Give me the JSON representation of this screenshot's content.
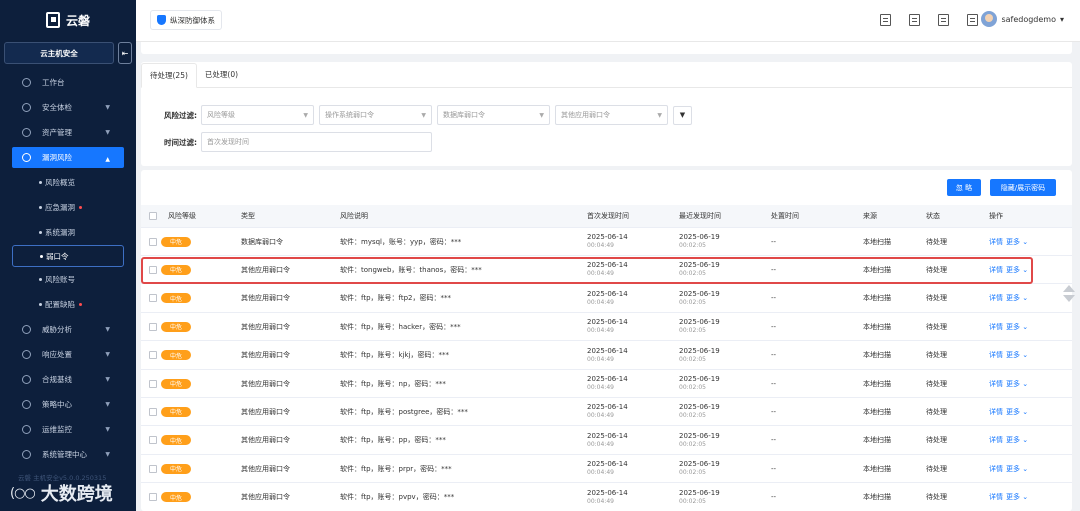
{
  "sidebar": {
    "brand": "云磐",
    "product": "云主机安全",
    "collapse_icon": "collapse-icon",
    "nav": [
      {
        "label": "工作台",
        "expandable": false
      },
      {
        "label": "安全体检",
        "expandable": true
      },
      {
        "label": "资产管理",
        "expandable": true
      }
    ],
    "active_group": "漏洞风险",
    "sub_items": [
      {
        "label": "风险概览",
        "dot": false
      },
      {
        "label": "应急漏洞",
        "dot": true
      },
      {
        "label": "系统漏洞",
        "dot": false
      },
      {
        "label": "弱口令",
        "dot": false,
        "selected": true
      },
      {
        "label": "风险账号",
        "dot": false
      },
      {
        "label": "配置缺陷",
        "dot": true
      }
    ],
    "nav_after": [
      {
        "label": "威胁分析"
      },
      {
        "label": "响应处置"
      },
      {
        "label": "合规基线"
      },
      {
        "label": "策略中心"
      },
      {
        "label": "运维监控"
      },
      {
        "label": "系统管理中心"
      }
    ],
    "version": "云磐 主机安全v5.0.0.250315",
    "watermark": "大数跨境"
  },
  "topbar": {
    "badge": "纵深防御体系",
    "username": "safedogdemo"
  },
  "tabs": [
    {
      "label": "待处理(25)",
      "active": true
    },
    {
      "label": "已处理(0)",
      "active": false
    }
  ],
  "filters": {
    "risk_label": "风险过滤:",
    "selects": [
      "风险等级",
      "操作系统弱口令",
      "数据库弱口令",
      "其他应用弱口令"
    ],
    "time_label": "时间过滤:",
    "time_placeholder": "首次发现时间"
  },
  "actions": {
    "ignore": "忽 略",
    "toggle_password": "隐藏/展示密码"
  },
  "table": {
    "headers": [
      "风险等级",
      "类型",
      "风险说明",
      "首次发现时间",
      "最近发现时间",
      "处置时间",
      "来源",
      "状态",
      "操作"
    ],
    "rows": [
      {
        "level": "中危",
        "type": "数据库弱口令",
        "desc": "软件：mysql，账号：yyp，密码：***",
        "first_date": "2025-06-14",
        "first_time": "00:04:49",
        "last_date": "2025-06-19",
        "last_time": "00:02:05",
        "handled": "--",
        "source": "本地扫描",
        "status": "待处理",
        "detail": "详情",
        "more": "更多 ⌄"
      },
      {
        "level": "中危",
        "type": "其他应用弱口令",
        "desc": "软件：tongweb，账号：thanos，密码：***",
        "first_date": "2025-06-14",
        "first_time": "00:04:49",
        "last_date": "2025-06-19",
        "last_time": "00:02:05",
        "handled": "--",
        "source": "本地扫描",
        "status": "待处理",
        "detail": "详情",
        "more": "更多 ⌄"
      },
      {
        "level": "中危",
        "type": "其他应用弱口令",
        "desc": "软件：ftp，账号：ftp2，密码：***",
        "first_date": "2025-06-14",
        "first_time": "00:04:49",
        "last_date": "2025-06-19",
        "last_time": "00:02:05",
        "handled": "--",
        "source": "本地扫描",
        "status": "待处理",
        "detail": "详情",
        "more": "更多 ⌄"
      },
      {
        "level": "中危",
        "type": "其他应用弱口令",
        "desc": "软件：ftp，账号：hacker，密码：***",
        "first_date": "2025-06-14",
        "first_time": "00:04:49",
        "last_date": "2025-06-19",
        "last_time": "00:02:05",
        "handled": "--",
        "source": "本地扫描",
        "status": "待处理",
        "detail": "详情",
        "more": "更多 ⌄"
      },
      {
        "level": "中危",
        "type": "其他应用弱口令",
        "desc": "软件：ftp，账号：kjkj，密码：***",
        "first_date": "2025-06-14",
        "first_time": "00:04:49",
        "last_date": "2025-06-19",
        "last_time": "00:02:05",
        "handled": "--",
        "source": "本地扫描",
        "status": "待处理",
        "detail": "详情",
        "more": "更多 ⌄"
      },
      {
        "level": "中危",
        "type": "其他应用弱口令",
        "desc": "软件：ftp，账号：np，密码：***",
        "first_date": "2025-06-14",
        "first_time": "00:04:49",
        "last_date": "2025-06-19",
        "last_time": "00:02:05",
        "handled": "--",
        "source": "本地扫描",
        "status": "待处理",
        "detail": "详情",
        "more": "更多 ⌄"
      },
      {
        "level": "中危",
        "type": "其他应用弱口令",
        "desc": "软件：ftp，账号：postgree，密码：***",
        "first_date": "2025-06-14",
        "first_time": "00:04:49",
        "last_date": "2025-06-19",
        "last_time": "00:02:05",
        "handled": "--",
        "source": "本地扫描",
        "status": "待处理",
        "detail": "详情",
        "more": "更多 ⌄"
      },
      {
        "level": "中危",
        "type": "其他应用弱口令",
        "desc": "软件：ftp，账号：pp，密码：***",
        "first_date": "2025-06-14",
        "first_time": "00:04:49",
        "last_date": "2025-06-19",
        "last_time": "00:02:05",
        "handled": "--",
        "source": "本地扫描",
        "status": "待处理",
        "detail": "详情",
        "more": "更多 ⌄"
      },
      {
        "level": "中危",
        "type": "其他应用弱口令",
        "desc": "软件：ftp，账号：prpr，密码：***",
        "first_date": "2025-06-14",
        "first_time": "00:04:49",
        "last_date": "2025-06-19",
        "last_time": "00:02:05",
        "handled": "--",
        "source": "本地扫描",
        "status": "待处理",
        "detail": "详情",
        "more": "更多 ⌄"
      },
      {
        "level": "中危",
        "type": "其他应用弱口令",
        "desc": "软件：ftp，账号：pvpv，密码：***",
        "first_date": "2025-06-14",
        "first_time": "00:04:49",
        "last_date": "2025-06-19",
        "last_time": "00:02:05",
        "handled": "--",
        "source": "本地扫描",
        "status": "待处理",
        "detail": "详情",
        "more": "更多 ⌄"
      }
    ]
  },
  "colors": {
    "sidebar_bg": "#0d1f3c",
    "accent": "#1677ff",
    "risk_medium": "#ff9f1a",
    "highlight": "#e04848"
  }
}
